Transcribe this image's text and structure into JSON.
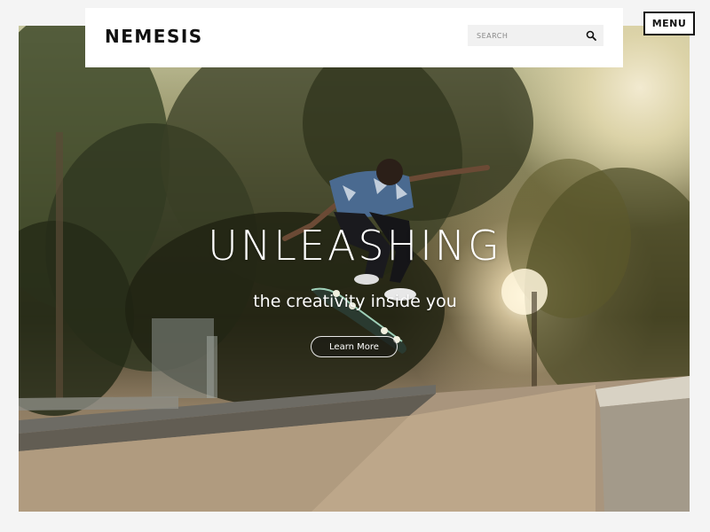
{
  "header": {
    "logo": "NEMESIS",
    "search": {
      "placeholder": "SEARCH",
      "value": ""
    },
    "menu_label": "MENU"
  },
  "hero": {
    "headline": "UNLEASHING",
    "subline": "the creativity inside you",
    "cta_label": "Learn More"
  },
  "colors": {
    "header_bg": "#ffffff",
    "text_dark": "#111111",
    "hero_text": "#ffffff",
    "search_bg": "#f1f1f1"
  },
  "icons": [
    "search-icon"
  ]
}
